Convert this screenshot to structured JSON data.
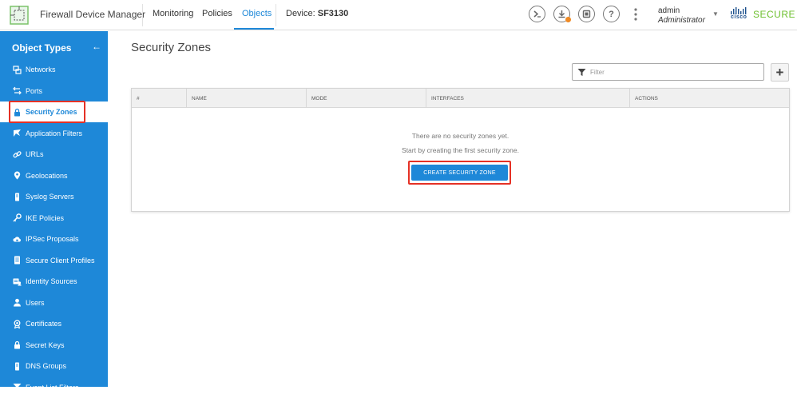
{
  "header": {
    "app_title": "Firewall Device Manager",
    "nav": [
      {
        "label": "Monitoring"
      },
      {
        "label": "Policies"
      },
      {
        "label": "Objects"
      }
    ],
    "device_label": "Device:",
    "device_name": "SF3130",
    "user_name": "admin",
    "user_role": "Administrator",
    "brand_cisco": "cisco",
    "brand_secure": "SECURE",
    "icons": [
      "terminal-icon",
      "deployment-icon",
      "task-list-icon",
      "help-icon",
      "more-options-icon"
    ],
    "help_glyph": "?"
  },
  "sidebar": {
    "title": "Object Types",
    "back_glyph": "←",
    "items": [
      {
        "label": "Networks",
        "icon": "networks-icon"
      },
      {
        "label": "Ports",
        "icon": "ports-icon"
      },
      {
        "label": "Security Zones",
        "icon": "lock-icon",
        "selected": true
      },
      {
        "label": "Application Filters",
        "icon": "application-filter-icon"
      },
      {
        "label": "URLs",
        "icon": "link-icon"
      },
      {
        "label": "Geolocations",
        "icon": "location-pin-icon"
      },
      {
        "label": "Syslog Servers",
        "icon": "server-icon"
      },
      {
        "label": "IKE Policies",
        "icon": "key-icon"
      },
      {
        "label": "IPSec Proposals",
        "icon": "cloud-lock-icon"
      },
      {
        "label": "Secure Client Profiles",
        "icon": "document-icon"
      },
      {
        "label": "Identity Sources",
        "icon": "identity-icon"
      },
      {
        "label": "Users",
        "icon": "user-icon"
      },
      {
        "label": "Certificates",
        "icon": "certificate-icon"
      },
      {
        "label": "Secret Keys",
        "icon": "lock-icon"
      },
      {
        "label": "DNS Groups",
        "icon": "dns-icon"
      },
      {
        "label": "Event List Filters",
        "icon": "filter-icon"
      }
    ]
  },
  "main": {
    "page_title": "Security Zones",
    "filter_placeholder": "Filter",
    "add_glyph": "+",
    "columns": [
      "#",
      "NAME",
      "MODE",
      "INTERFACES",
      "ACTIONS"
    ],
    "empty_line1": "There are no security zones yet.",
    "empty_line2": "Start by creating the first security zone.",
    "create_button": "CREATE SECURITY ZONE"
  },
  "colors": {
    "accent": "#1e88d8",
    "highlight": "#e53125",
    "secure_green": "#6cbf2c",
    "notification_orange": "#f08a24"
  }
}
